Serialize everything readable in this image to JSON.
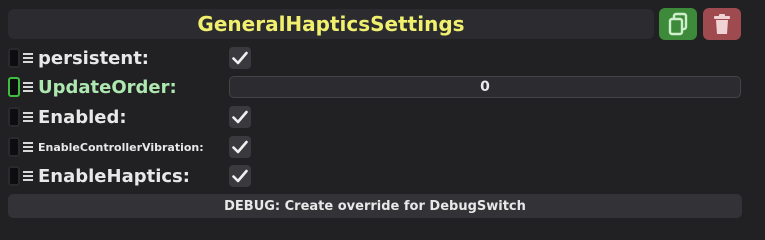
{
  "header": {
    "title": "GeneralHapticsSettings"
  },
  "fields": {
    "persistent": {
      "label": "persistent:",
      "checked": true
    },
    "update_order": {
      "label": "UpdateOrder:",
      "value": "0"
    },
    "enabled": {
      "label": "Enabled:",
      "checked": true
    },
    "enable_controller_vibration": {
      "label": "EnableControllerVibration:",
      "checked": true
    },
    "enable_haptics": {
      "label": "EnableHaptics:",
      "checked": true
    }
  },
  "debug_button": {
    "label": "DEBUG: Create override for DebugSwitch"
  },
  "icons": {
    "copy": "copy-icon",
    "delete": "trash-icon",
    "check": "checkmark-icon",
    "menu": "menu-icon"
  },
  "colors": {
    "title": "#f0ef6e",
    "copy_button": "#3d8a3a",
    "delete_button": "#9e4a4f",
    "active_handle": "#3fbf3f",
    "highlighted_label": "#aee8b0"
  }
}
